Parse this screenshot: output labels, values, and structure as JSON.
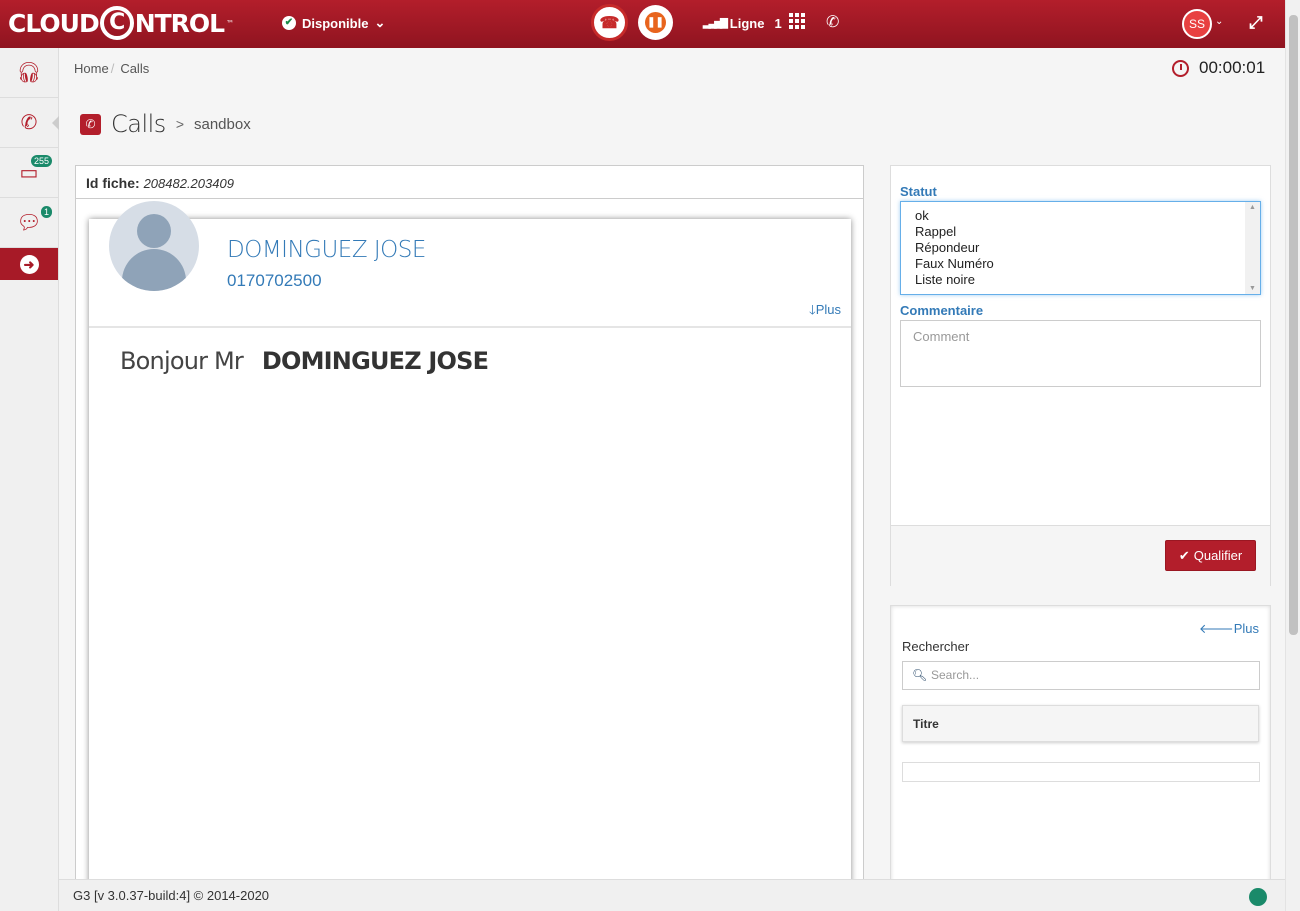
{
  "topbar": {
    "logo_left": "CLOUD",
    "logo_ring": "C",
    "logo_right": "NTROL",
    "logo_tm": "™",
    "status": "Disponible",
    "status_chev": "⌄",
    "ligne_label": "Ligne",
    "ligne_value": "1",
    "avatar": "SS",
    "avatar_chev": "⌄"
  },
  "sidebar": {
    "inbox_badge": "255",
    "chat_badge": "1"
  },
  "breadcrumb": {
    "home": "Home",
    "sep": "/",
    "current": "Calls"
  },
  "timer": "00:00:01",
  "page": {
    "title": "Calls",
    "gt": ">",
    "subtitle": "sandbox"
  },
  "fiche": {
    "id_label": "Id fiche:",
    "id_value": "208482.203409",
    "name": "DOMINGUEZ JOSE",
    "phone": "0170702500",
    "plus": "Plus",
    "greeting": "Bonjour Mr",
    "greeting_name": "DOMINGUEZ JOSE"
  },
  "qualif": {
    "statut_label": "Statut",
    "options": [
      "ok",
      "Rappel",
      "Répondeur",
      "Faux Numéro",
      "Liste noire"
    ],
    "comment_label": "Commentaire",
    "comment_placeholder": "Comment",
    "button": "Qualifier"
  },
  "search_panel": {
    "plus": "Plus",
    "label": "Rechercher",
    "placeholder": "Search...",
    "col_titre": "Titre"
  },
  "footer": {
    "version": "G3 [v 3.0.37-build:4] © 2014-2020"
  },
  "colors": {
    "brand": "#b31e2b",
    "link": "#337ab7",
    "online": "#1a8a6a"
  }
}
